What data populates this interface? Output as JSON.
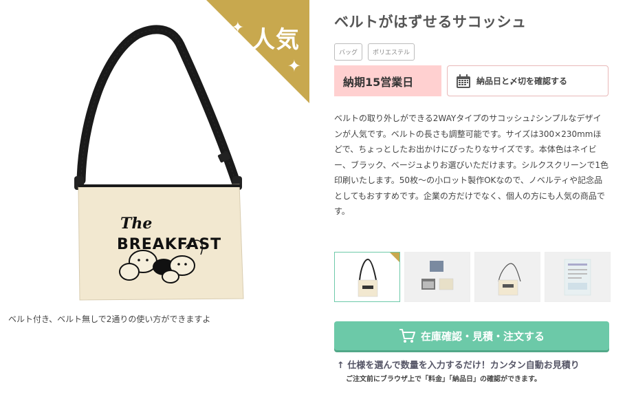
{
  "product": {
    "title": "ベルトがはずせるサコッシュ",
    "badge": "人気",
    "image_caption": "ベルト付き、ベルト無しで2通りの使い方ができますよ",
    "print_logo_line1": "The",
    "print_logo_line2": "BREAKFAST",
    "tags": [
      "バッグ",
      "ポリエステル"
    ],
    "lead_time": "納期15営業日",
    "confirm_deadline_label": "納品日と〆切を確認する",
    "description": "ベルトの取り外しができる2WAYタイプのサコッシュ♪シンプルなデザインが人気です。ベルトの長さも調整可能です。サイズは300×230mmほどで、ちょっとしたお出かけにぴったりなサイズです。本体色はネイビー、ブラック、ベージュよりお選びいただけます。シルクスクリーンで1色印刷いたします。50枚〜の小ロット製作OKなので、ノベルティや記念品としてもおすすめです。企業の方だけでなく、個人の方にも人気の商品です。"
  },
  "order": {
    "button_label": "在庫確認・見積・注文する",
    "note_main": "↑ 仕様を選んで数量を入力するだけ！カンタン自動お見積り",
    "note_sub": "ご注文前にブラウザ上で「料金」「納品日」の確認ができます。"
  },
  "icons": {
    "calendar": "calendar-icon",
    "cart": "cart-icon",
    "sparkle": "sparkle-icon"
  },
  "colors": {
    "gold": "#c8a84e",
    "leadtime_bg": "#ffd0d0",
    "accent_green": "#6cc9a8"
  }
}
